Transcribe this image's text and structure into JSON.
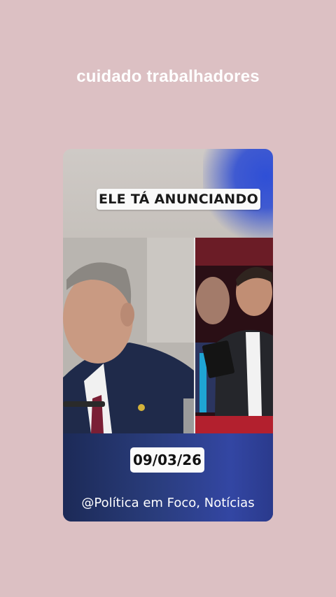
{
  "story": {
    "caption": "cuidado trabalhadores",
    "video": {
      "headline": "ELE TÁ ANUNCIANDO",
      "date": "09/03/26",
      "credit": "@Política em Foco, Notícias"
    }
  }
}
